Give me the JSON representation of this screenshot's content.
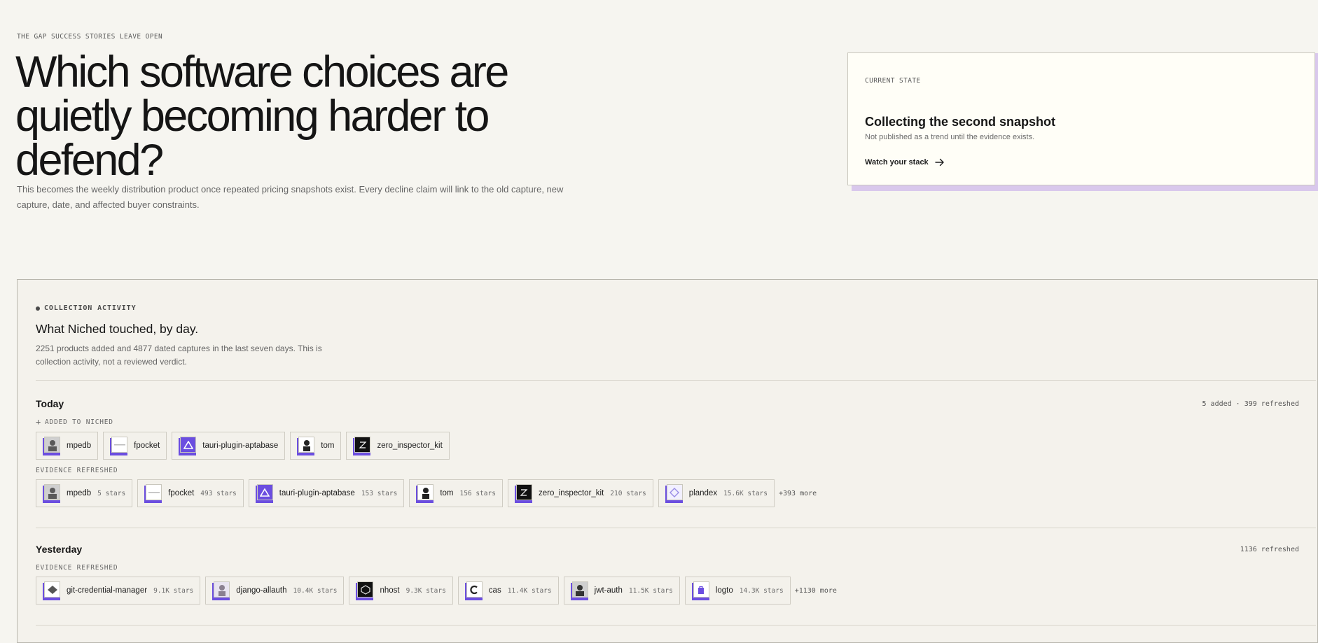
{
  "hero": {
    "eyebrow": "THE GAP SUCCESS STORIES LEAVE OPEN",
    "title": "Which software choices are quietly becoming harder to defend?",
    "description": "This becomes the weekly distribution product once repeated pricing snapshots exist. Every decline claim will link to the old capture, new capture, date, and affected buyer constraints."
  },
  "state_card": {
    "label": "CURRENT STATE",
    "title": "Collecting the second snapshot",
    "subtitle": "Not published as a trend until the evidence exists.",
    "link": "Watch your stack",
    "link_icon": "arrow-right-icon",
    "accent_color": "#d9c8ec"
  },
  "activity": {
    "label": "COLLECTION ACTIVITY",
    "title": "What Niched touched, by day.",
    "description": "2251 products added and 4877 dated captures in the last seven days. This is collection activity, not a reviewed verdict.",
    "accent_color": "#6b4ee0",
    "days": [
      {
        "title": "Today",
        "stat": "5 added · 399 refreshed",
        "added_label": "ADDED TO NICHED",
        "added": [
          "mpedb",
          "fpocket",
          "tauri-plugin-aptabase",
          "tom",
          "zero_inspector_kit"
        ],
        "refreshed_label": "EVIDENCE REFRESHED",
        "refreshed": [
          {
            "name": "mpedb",
            "stars": "5 stars"
          },
          {
            "name": "fpocket",
            "stars": "493 stars"
          },
          {
            "name": "tauri-plugin-aptabase",
            "stars": "153 stars"
          },
          {
            "name": "tom",
            "stars": "156 stars"
          },
          {
            "name": "zero_inspector_kit",
            "stars": "210 stars"
          },
          {
            "name": "plandex",
            "stars": "15.6K stars"
          }
        ],
        "more": "+393 more"
      },
      {
        "title": "Yesterday",
        "stat": "1136 refreshed",
        "refreshed_label": "EVIDENCE REFRESHED",
        "refreshed": [
          {
            "name": "git-credential-manager",
            "stars": "9.1K stars"
          },
          {
            "name": "django-allauth",
            "stars": "10.4K stars"
          },
          {
            "name": "nhost",
            "stars": "9.3K stars"
          },
          {
            "name": "cas",
            "stars": "11.4K stars"
          },
          {
            "name": "jwt-auth",
            "stars": "11.5K stars"
          },
          {
            "name": "logto",
            "stars": "14.3K stars"
          }
        ],
        "more": "+1130 more"
      }
    ]
  }
}
